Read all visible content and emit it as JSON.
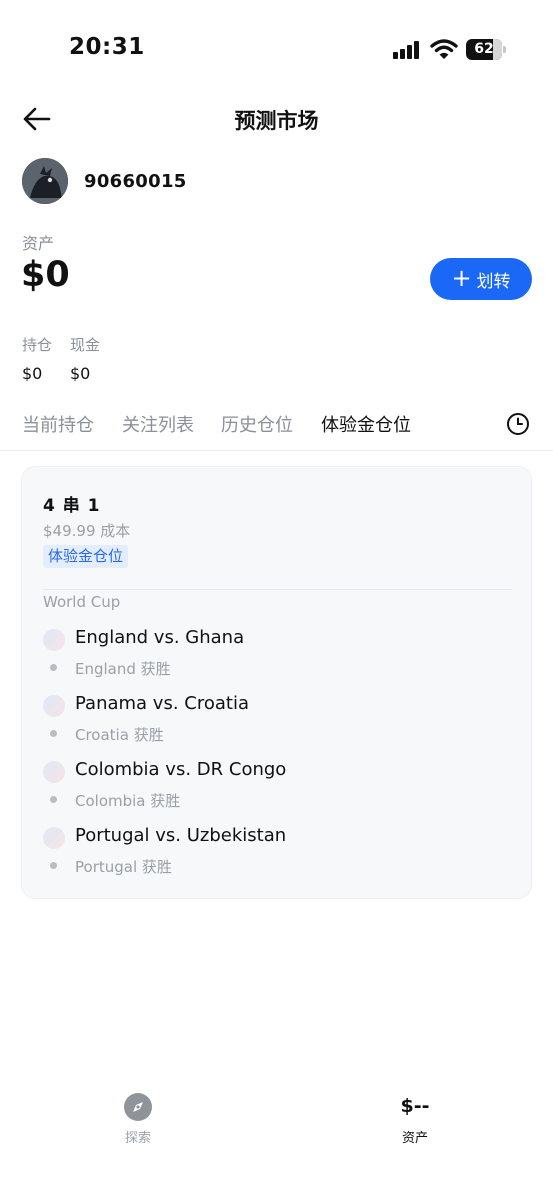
{
  "status_bar": {
    "time": "20:31",
    "battery": "62",
    "icons": [
      "signal-icon",
      "wifi-icon",
      "battery-icon"
    ]
  },
  "header": {
    "title": "预测市场",
    "back_icon": "arrow-left-icon"
  },
  "user": {
    "id": "90660015"
  },
  "assets": {
    "label": "资产",
    "value": "$0",
    "transfer_label": "划转",
    "transfer_icon": "plus-icon",
    "accent_color": "#1a68f5",
    "holdings_label": "持仓",
    "holdings_value": "$0",
    "cash_label": "现金",
    "cash_value": "$0"
  },
  "tabs": [
    {
      "label": "当前持仓",
      "active": false
    },
    {
      "label": "关注列表",
      "active": false
    },
    {
      "label": "历史仓位",
      "active": false
    },
    {
      "label": "体验金仓位",
      "active": true
    }
  ],
  "history_icon": "clock-icon",
  "position_card": {
    "title": "4 串 1",
    "cost": "$49.99 成本",
    "badge": "体验金仓位",
    "league": "World Cup",
    "matches": [
      {
        "name": "England vs. Ghana",
        "pick": "England 获胜"
      },
      {
        "name": "Panama vs. Croatia",
        "pick": "Croatia 获胜"
      },
      {
        "name": "Colombia vs. DR Congo",
        "pick": "Colombia 获胜"
      },
      {
        "name": "Portugal vs. Uzbekistan",
        "pick": "Portugal 获胜"
      }
    ]
  },
  "bottom_nav": {
    "explore_label": "探索",
    "explore_icon": "compass-icon",
    "assets_value": "$--",
    "assets_label": "资产"
  }
}
